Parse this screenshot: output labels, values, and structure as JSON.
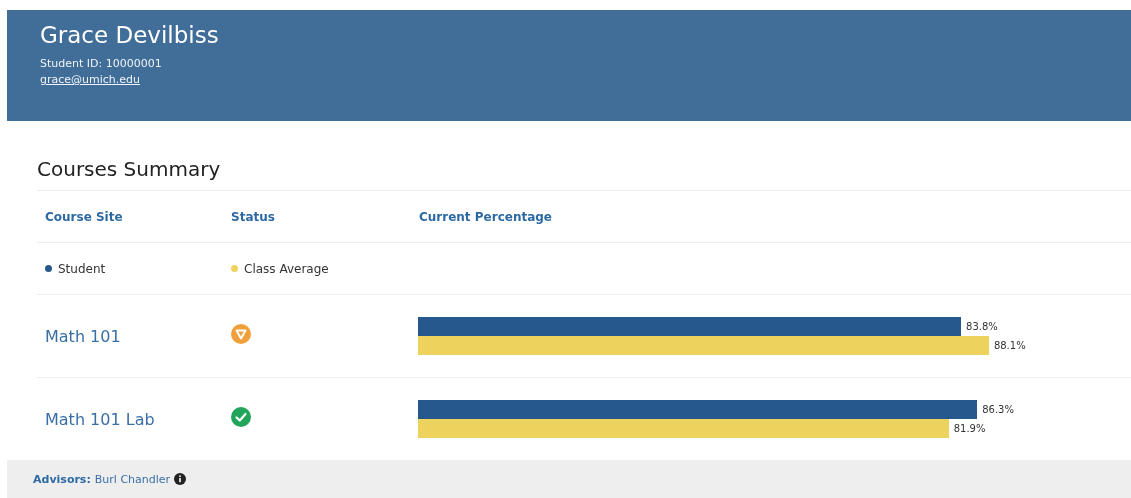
{
  "header": {
    "name": "Grace Devilbiss",
    "student_id": "Student ID: 10000001",
    "email": "grace@umich.edu"
  },
  "summary": {
    "title": "Courses Summary",
    "columns": [
      "Course Site",
      "Status",
      "Current Percentage"
    ],
    "legend": [
      {
        "label": "Student",
        "color": "#27588d"
      },
      {
        "label": "Class Average",
        "color": "#eed25e"
      }
    ],
    "courses": [
      {
        "name": "Math 101",
        "kind": "warning",
        "readings": [
          "83.8%",
          "88.1%"
        ]
      },
      {
        "name": "Math 101 Lab",
        "kind": "ok",
        "readings": [
          "86.3%",
          "81.9%"
        ]
      }
    ]
  },
  "footer": {
    "label": "Advisors:",
    "advisor": "Burl Chandler"
  }
}
